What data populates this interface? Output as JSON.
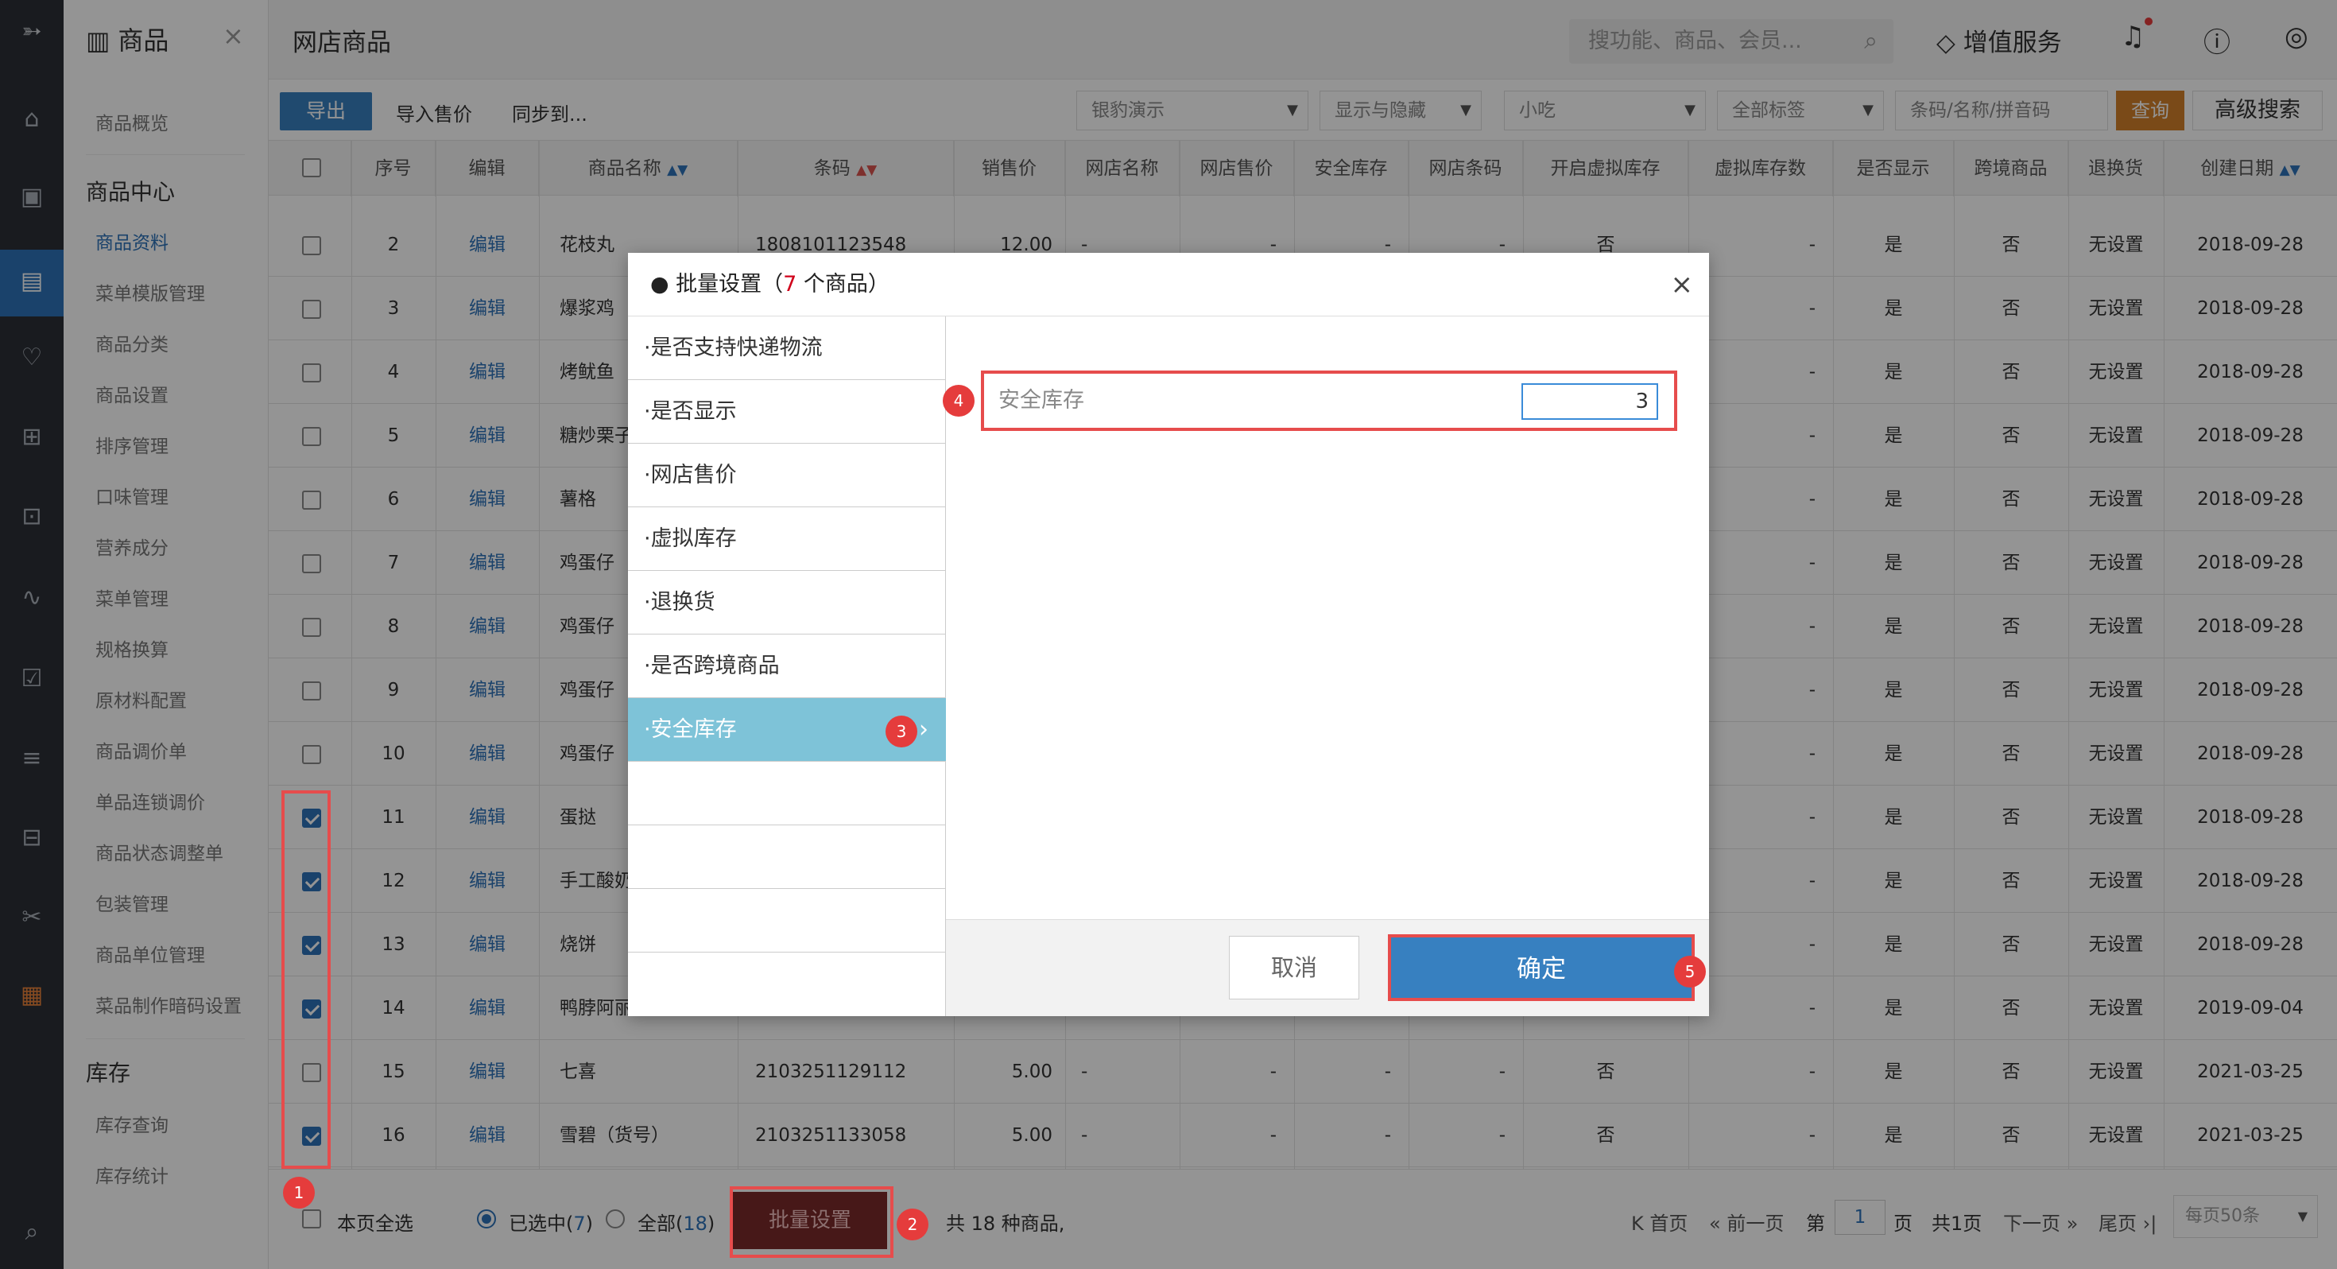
{
  "rail": {
    "icons": [
      "logo-icon",
      "home-icon",
      "wallet-icon",
      "goods-icon",
      "member-icon",
      "coupon-icon",
      "card-icon",
      "chart-icon",
      "report-icon",
      "settings-sliders-icon",
      "account-icon",
      "tools-icon",
      "apps-icon",
      "search-list-icon"
    ]
  },
  "sidebar": {
    "title": "商品",
    "close": "×",
    "top_item": "商品概览",
    "group1": "商品中心",
    "items": [
      "商品资料",
      "菜单模版管理",
      "商品分类",
      "商品设置",
      "排序管理",
      "口味管理",
      "营养成分",
      "菜单管理",
      "规格换算",
      "原材料配置",
      "商品调价单",
      "单品连锁调价",
      "商品状态调整单",
      "包装管理",
      "商品单位管理",
      "菜品制作暗码设置"
    ],
    "active_index": 0,
    "group2": "库存",
    "items2": [
      "库存查询",
      "库存统计"
    ]
  },
  "topbar": {
    "page_title": "网店商品",
    "search_placeholder": "搜功能、商品、会员...",
    "value_service": "增值服务"
  },
  "toolbar": {
    "export": "导出",
    "import_price": "导入售价",
    "sync_to": "同步到...",
    "select1": "银豹演示",
    "select2": "显示与隐藏",
    "select3": "小吃",
    "select4": "全部标签",
    "code_placeholder": "条码/名称/拼音码",
    "query": "查询",
    "advanced": "高级搜索"
  },
  "table": {
    "headers": [
      "序号",
      "编辑",
      "商品名称",
      "条码",
      "销售价",
      "网店名称",
      "网店售价",
      "安全库存",
      "网店条码",
      "开启虚拟库存",
      "虚拟库存数",
      "是否显示",
      "跨境商品",
      "退换货",
      "创建日期"
    ],
    "rows": [
      {
        "no": "2",
        "edit": "编辑",
        "name": "花枝丸",
        "barcode": "1808101123548",
        "price": "12.00",
        "shop_name": "-",
        "shop_price": "-",
        "safe_stock": "-",
        "shop_code": "-",
        "virtual": "否",
        "virtual_count": "-",
        "show": "是",
        "cross": "否",
        "returns": "无设置",
        "date": "2018-09-28",
        "checked": false
      },
      {
        "no": "3",
        "edit": "编辑",
        "name": "爆浆鸡",
        "barcode": "",
        "price": "",
        "shop_name": "",
        "shop_price": "",
        "safe_stock": "",
        "shop_code": "",
        "virtual": "",
        "virtual_count": "-",
        "show": "是",
        "cross": "否",
        "returns": "无设置",
        "date": "2018-09-28",
        "checked": false
      },
      {
        "no": "4",
        "edit": "编辑",
        "name": "烤鱿鱼",
        "barcode": "",
        "price": "",
        "shop_name": "",
        "shop_price": "",
        "safe_stock": "",
        "shop_code": "",
        "virtual": "",
        "virtual_count": "-",
        "show": "是",
        "cross": "否",
        "returns": "无设置",
        "date": "2018-09-28",
        "checked": false
      },
      {
        "no": "5",
        "edit": "编辑",
        "name": "糖炒栗子",
        "barcode": "",
        "price": "",
        "shop_name": "",
        "shop_price": "",
        "safe_stock": "",
        "shop_code": "",
        "virtual": "",
        "virtual_count": "-",
        "show": "是",
        "cross": "否",
        "returns": "无设置",
        "date": "2018-09-28",
        "checked": false
      },
      {
        "no": "6",
        "edit": "编辑",
        "name": "薯格",
        "barcode": "",
        "price": "",
        "shop_name": "",
        "shop_price": "",
        "safe_stock": "",
        "shop_code": "",
        "virtual": "",
        "virtual_count": "-",
        "show": "是",
        "cross": "否",
        "returns": "无设置",
        "date": "2018-09-28",
        "checked": false
      },
      {
        "no": "7",
        "edit": "编辑",
        "name": "鸡蛋仔",
        "barcode": "",
        "price": "",
        "shop_name": "",
        "shop_price": "",
        "safe_stock": "",
        "shop_code": "",
        "virtual": "",
        "virtual_count": "-",
        "show": "是",
        "cross": "否",
        "returns": "无设置",
        "date": "2018-09-28",
        "checked": false
      },
      {
        "no": "8",
        "edit": "编辑",
        "name": "鸡蛋仔",
        "barcode": "",
        "price": "",
        "shop_name": "",
        "shop_price": "",
        "safe_stock": "",
        "shop_code": "",
        "virtual": "",
        "virtual_count": "-",
        "show": "是",
        "cross": "否",
        "returns": "无设置",
        "date": "2018-09-28",
        "checked": false
      },
      {
        "no": "9",
        "edit": "编辑",
        "name": "鸡蛋仔",
        "barcode": "",
        "price": "",
        "shop_name": "",
        "shop_price": "",
        "safe_stock": "",
        "shop_code": "",
        "virtual": "",
        "virtual_count": "-",
        "show": "是",
        "cross": "否",
        "returns": "无设置",
        "date": "2018-09-28",
        "checked": false
      },
      {
        "no": "10",
        "edit": "编辑",
        "name": "鸡蛋仔",
        "barcode": "",
        "price": "",
        "shop_name": "",
        "shop_price": "",
        "safe_stock": "",
        "shop_code": "",
        "virtual": "",
        "virtual_count": "-",
        "show": "是",
        "cross": "否",
        "returns": "无设置",
        "date": "2018-09-28",
        "checked": false
      },
      {
        "no": "11",
        "edit": "编辑",
        "name": "蛋挞",
        "barcode": "",
        "price": "",
        "shop_name": "",
        "shop_price": "",
        "safe_stock": "",
        "shop_code": "",
        "virtual": "",
        "virtual_count": "-",
        "show": "是",
        "cross": "否",
        "returns": "无设置",
        "date": "2018-09-28",
        "checked": true
      },
      {
        "no": "12",
        "edit": "编辑",
        "name": "手工酸奶",
        "barcode": "",
        "price": "",
        "shop_name": "",
        "shop_price": "",
        "safe_stock": "",
        "shop_code": "",
        "virtual": "",
        "virtual_count": "-",
        "show": "是",
        "cross": "否",
        "returns": "无设置",
        "date": "2018-09-28",
        "checked": true
      },
      {
        "no": "13",
        "edit": "编辑",
        "name": "烧饼",
        "barcode": "",
        "price": "",
        "shop_name": "",
        "shop_price": "",
        "safe_stock": "",
        "shop_code": "",
        "virtual": "",
        "virtual_count": "-",
        "show": "是",
        "cross": "否",
        "returns": "无设置",
        "date": "2018-09-28",
        "checked": true
      },
      {
        "no": "14",
        "edit": "编辑",
        "name": "鸭脖阿丽",
        "barcode": "",
        "price": "",
        "shop_name": "",
        "shop_price": "",
        "safe_stock": "",
        "shop_code": "",
        "virtual": "",
        "virtual_count": "-",
        "show": "是",
        "cross": "否",
        "returns": "无设置",
        "date": "2019-09-04",
        "checked": true
      },
      {
        "no": "15",
        "edit": "编辑",
        "name": "七喜",
        "barcode": "2103251129112",
        "price": "5.00",
        "shop_name": "-",
        "shop_price": "-",
        "safe_stock": "-",
        "shop_code": "-",
        "virtual": "否",
        "virtual_count": "-",
        "show": "是",
        "cross": "否",
        "returns": "无设置",
        "date": "2021-03-25",
        "checked": false
      },
      {
        "no": "16",
        "edit": "编辑",
        "name": "雪碧（货号）",
        "barcode": "2103251133058",
        "price": "5.00",
        "shop_name": "-",
        "shop_price": "-",
        "safe_stock": "-",
        "shop_code": "-",
        "virtual": "否",
        "virtual_count": "-",
        "show": "是",
        "cross": "否",
        "returns": "无设置",
        "date": "2021-03-25",
        "checked": true
      }
    ]
  },
  "footer": {
    "select_page": "本页全选",
    "selected_label": "已选中(",
    "selected_count": "7",
    "close_paren": ")",
    "all_label": "全部(",
    "all_count": "18",
    "batch_btn": "批量设置",
    "total_text": "共 18 种商品,",
    "first": "首页",
    "prev": "前一页",
    "page_prefix": "第",
    "page_value": "1",
    "page_suffix": "页",
    "total_pages": "共1页",
    "next": "下一页",
    "last": "尾页",
    "per_page": "每页50条"
  },
  "modal": {
    "title_prefix": "● 批量设置（",
    "title_count": "7",
    "title_suffix": " 个商品）",
    "close": "×",
    "nav": [
      "·是否支持快递物流",
      "·是否显示",
      "·网店售价",
      "·虚拟库存",
      "·退换货",
      "·是否跨境商品",
      "·安全库存"
    ],
    "active_index": 6,
    "field_label": "安全库存",
    "field_value": "3",
    "cancel": "取消",
    "confirm": "确定"
  },
  "annotations": [
    "1",
    "2",
    "3",
    "4",
    "5"
  ],
  "colors": {
    "primary": "#3780c0",
    "highlight": "#e64c4c",
    "nav_active": "#7ec3d8",
    "query": "#d3802a"
  }
}
